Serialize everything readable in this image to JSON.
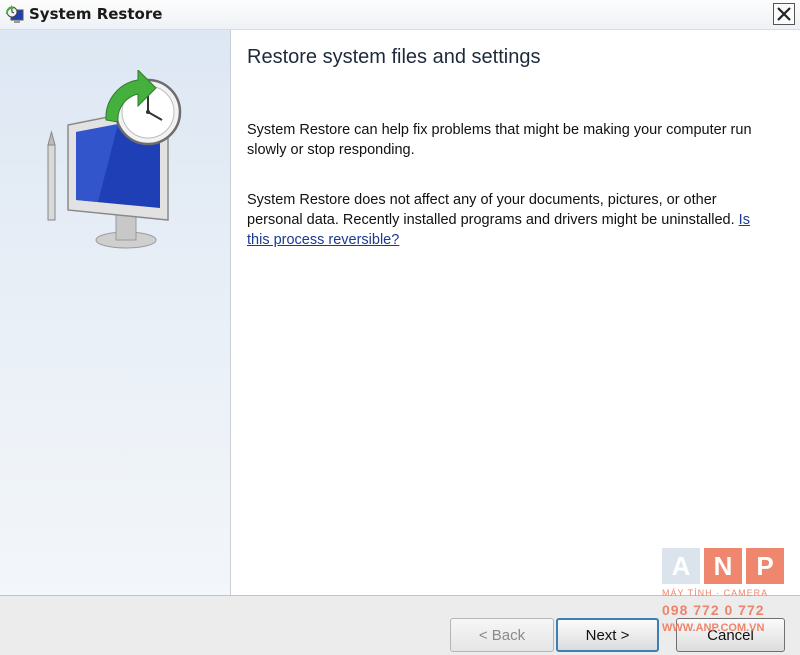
{
  "window": {
    "title": "System Restore",
    "close_glyph": "✕"
  },
  "content": {
    "heading": "Restore system files and settings",
    "paragraph1": "System Restore can help fix problems that might be making your computer run slowly or stop responding.",
    "paragraph2": "System Restore does not affect any of your documents, pictures, or other personal data. Recently installed programs and drivers might be uninstalled.",
    "link_text": "Is this process reversible?"
  },
  "footer": {
    "back_label": "< Back",
    "next_label": "Next >",
    "cancel_label": "Cancel"
  },
  "watermark": {
    "letters": [
      "A",
      "N",
      "P"
    ],
    "tagline": "MÁY TÍNH · CAMERA",
    "phone": "098 772 0 772",
    "site": "WWW.ANP.COM.VN"
  },
  "icons": {
    "title": "system-restore-icon",
    "hero": "monitor-clock-restore-icon",
    "close": "close-icon"
  },
  "colors": {
    "link": "#1a3a8f",
    "sidebar": "#dde7f3",
    "arrow_green": "#46b03f",
    "screen_blue": "#1e3fb5",
    "watermark_accent": "#ee7c62"
  }
}
